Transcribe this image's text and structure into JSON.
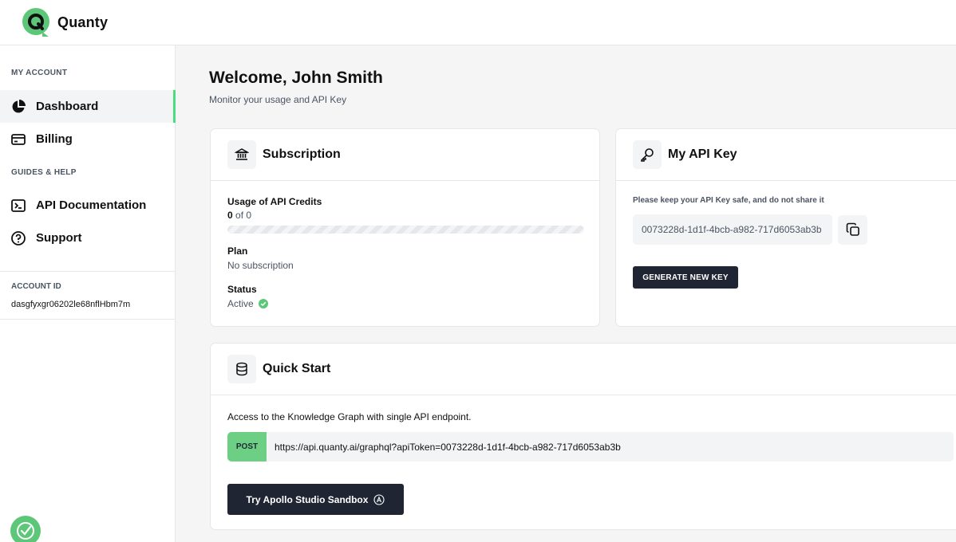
{
  "brand": {
    "name": "Quanty",
    "accent": "#5cc778"
  },
  "sidebar": {
    "my_account_label": "MY ACCOUNT",
    "guides_label": "GUIDES & HELP",
    "items": [
      {
        "label": "Dashboard",
        "icon": "pie-chart-icon",
        "active": true
      },
      {
        "label": "Billing",
        "icon": "credit-card-icon",
        "active": false
      },
      {
        "label": "API Documentation",
        "icon": "terminal-icon",
        "active": false
      },
      {
        "label": "Support",
        "icon": "question-circle-icon",
        "active": false
      }
    ],
    "account_id_label": "ACCOUNT ID",
    "account_id": "dasgfyxgr06202le68nflHbm7m"
  },
  "main": {
    "welcome": "Welcome, John Smith",
    "subtitle": "Monitor your usage and API Key"
  },
  "subscription": {
    "title": "Subscription",
    "usage_label": "Usage of API Credits",
    "usage_used": "0",
    "usage_of": " of 0",
    "plan_label": "Plan",
    "plan_value": "No subscription",
    "status_label": "Status",
    "status_value": "Active",
    "status_color": "#5cc778"
  },
  "api_key": {
    "title": "My API Key",
    "note": "Please keep your API Key safe, and do not share it",
    "value": "0073228d-1d1f-4bcb-a982-717d6053ab3b",
    "generate_label": "GENERATE NEW KEY"
  },
  "quick_start": {
    "title": "Quick Start",
    "description": "Access to the Knowledge Graph with single API endpoint.",
    "method": "POST",
    "endpoint": "https://api.quanty.ai/graphql?apiToken=0073228d-1d1f-4bcb-a982-717d6053ab3b",
    "sandbox_label": "Try Apollo Studio Sandbox"
  }
}
